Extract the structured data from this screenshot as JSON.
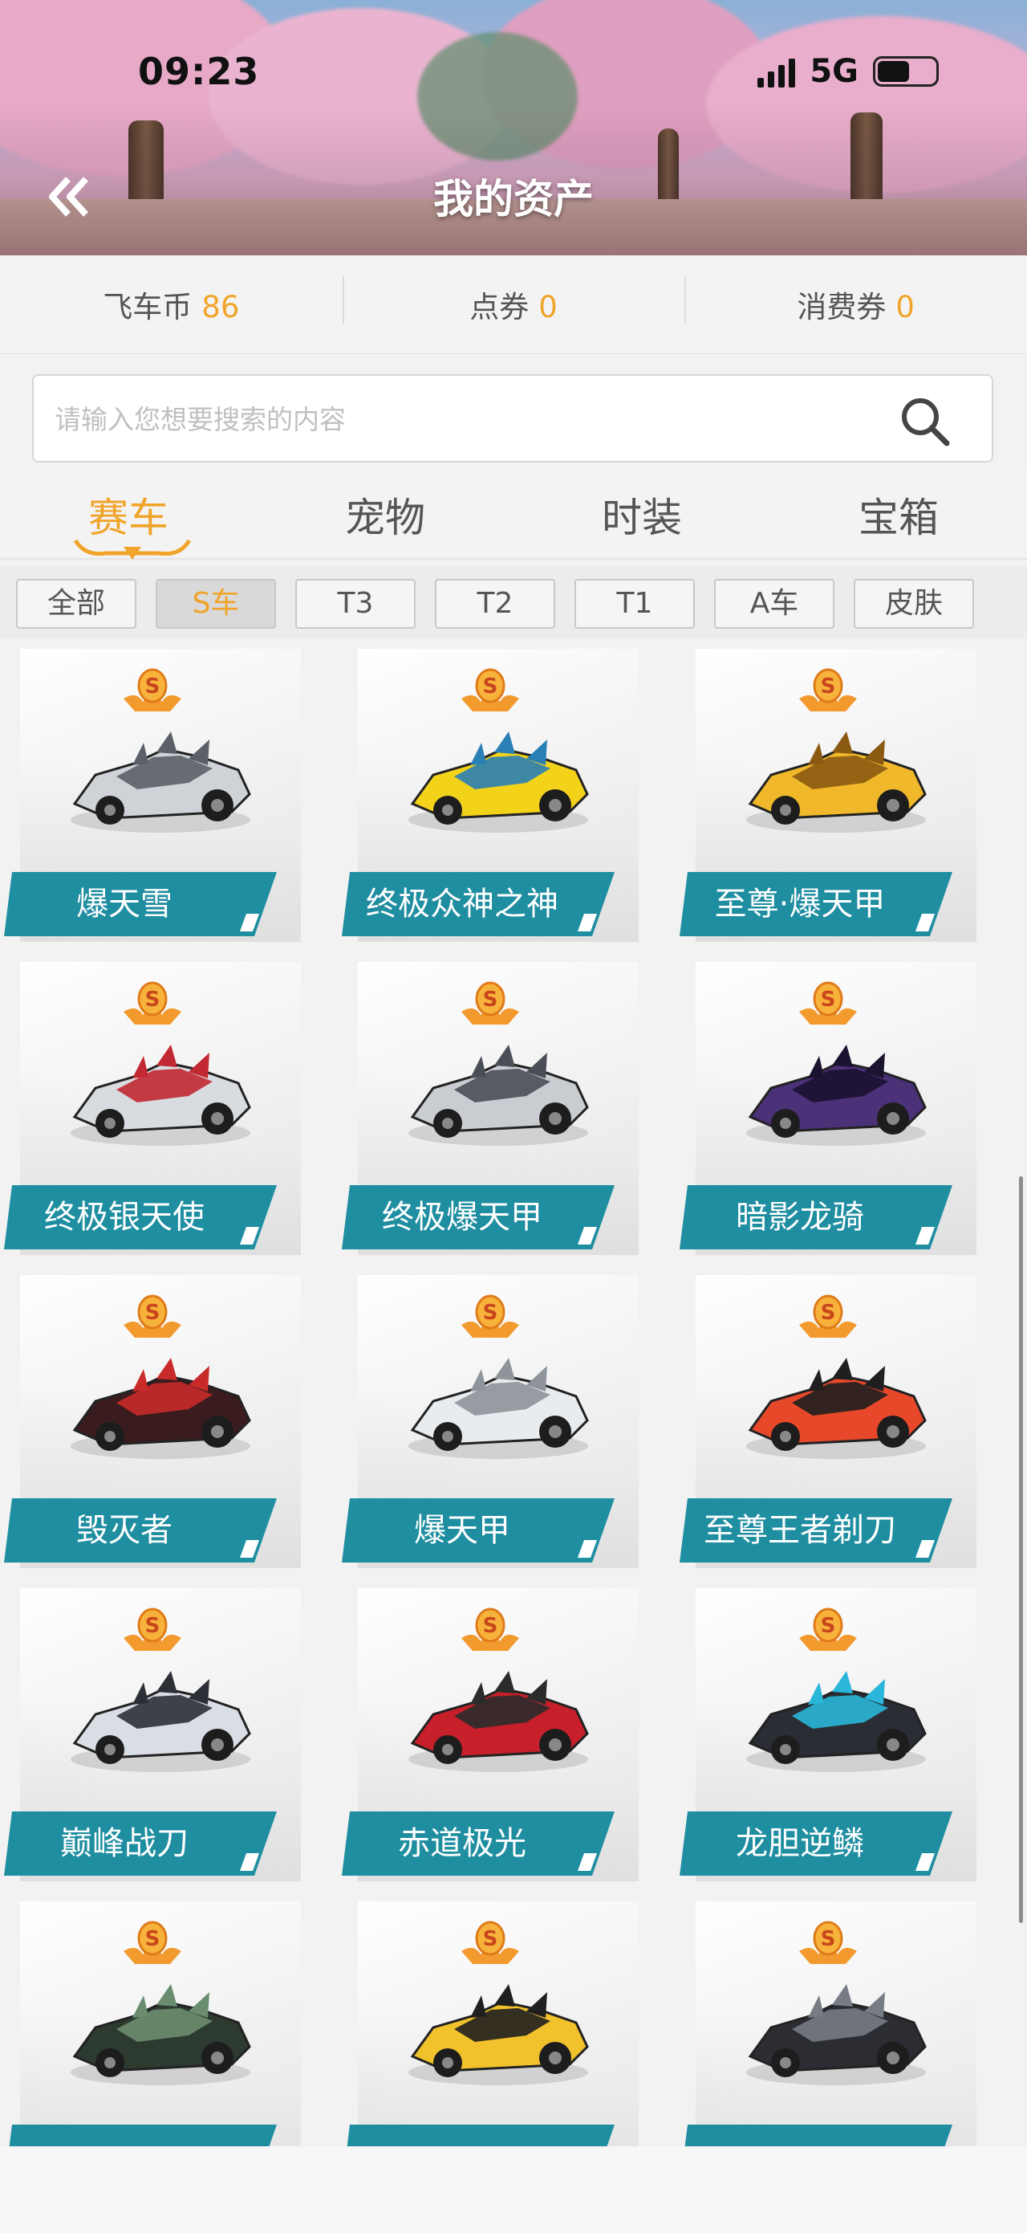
{
  "status_bar": {
    "time": "09:23",
    "network": "5G"
  },
  "header": {
    "title": "我的资产"
  },
  "balances": [
    {
      "label": "飞车币",
      "value": "86"
    },
    {
      "label": "点券",
      "value": "0"
    },
    {
      "label": "消费券",
      "value": "0"
    }
  ],
  "search": {
    "placeholder": "请输入您想要搜索的内容"
  },
  "tabs": [
    "赛车",
    "宠物",
    "时装",
    "宝箱"
  ],
  "active_tab": "赛车",
  "filters": [
    "全部",
    "S车",
    "T3",
    "T2",
    "T1",
    "A车",
    "皮肤"
  ],
  "active_filter": "S车",
  "cars": [
    {
      "name": "爆天雪"
    },
    {
      "name": "终极众神之神"
    },
    {
      "name": "至尊·爆天甲"
    },
    {
      "name": "终极银天使"
    },
    {
      "name": "终极爆天甲"
    },
    {
      "name": "暗影龙骑"
    },
    {
      "name": "毁灭者"
    },
    {
      "name": "爆天甲"
    },
    {
      "name": "至尊王者剃刀"
    },
    {
      "name": "巅峰战刀"
    },
    {
      "name": "赤道极光"
    },
    {
      "name": "龙胆逆鳞"
    },
    {
      "name": ""
    },
    {
      "name": ""
    },
    {
      "name": ""
    }
  ],
  "colors": {
    "accent": "#f0a429",
    "label_teal": "#1f8ea1"
  }
}
